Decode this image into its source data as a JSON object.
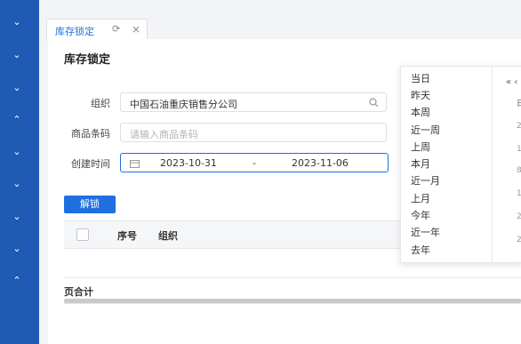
{
  "sidebar": {
    "chevrons": [
      "⌄",
      "⌄",
      "⌄",
      "⌃",
      "⌄",
      "⌄",
      "⌄",
      "⌄",
      "⌃"
    ]
  },
  "tab": {
    "label": "库存锁定",
    "refresh": "⟳",
    "close": "×"
  },
  "page": {
    "title": "库存锁定"
  },
  "form": {
    "org_label": "组织",
    "org_value": "中国石油重庆销售分公司",
    "barcode_label": "商品条码",
    "barcode_placeholder": "请输入商品条码",
    "created_label": "创建时间",
    "date_start": "2023-10-31",
    "date_sep": "-",
    "date_end": "2023-11-06"
  },
  "actions": {
    "unlock_label": "解锁"
  },
  "table": {
    "columns": [
      "序号",
      "组织"
    ],
    "footer_label": "页合计"
  },
  "date_shortcuts": [
    "当日",
    "昨天",
    "本周",
    "近一周",
    "上周",
    "本月",
    "近一月",
    "上月",
    "今年",
    "近一年",
    "去年"
  ],
  "calendar": {
    "nav": "« ‹",
    "fragments": [
      "日",
      "2",
      "1",
      "8",
      "1",
      "2",
      "2"
    ]
  },
  "colors": {
    "primary": "#1e6fe0",
    "sidebar": "#1f5bb5"
  }
}
